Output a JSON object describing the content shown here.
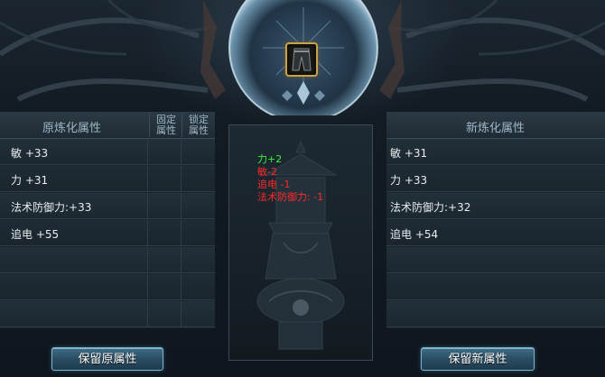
{
  "left_panel": {
    "title": "原炼化属性",
    "col_fixed": "固定属性",
    "col_lock": "锁定属性",
    "rows": [
      {
        "text": "敏 +33"
      },
      {
        "text": "力 +31"
      },
      {
        "text": "法术防御力:+33"
      },
      {
        "text": "追电 +55"
      },
      {
        "text": ""
      },
      {
        "text": ""
      },
      {
        "text": ""
      }
    ],
    "button": "保留原属性"
  },
  "right_panel": {
    "title": "新炼化属性",
    "rows": [
      {
        "text": "敏 +31"
      },
      {
        "text": "力 +33"
      },
      {
        "text": "法术防御力:+32"
      },
      {
        "text": "追电 +54"
      },
      {
        "text": ""
      },
      {
        "text": ""
      },
      {
        "text": ""
      }
    ],
    "button": "保留新属性"
  },
  "diff": [
    {
      "text": "力+2",
      "kind": "pos"
    },
    {
      "text": "敏-2",
      "kind": "neg"
    },
    {
      "text": "追电 -1",
      "kind": "neg"
    },
    {
      "text": "法术防御力: -1",
      "kind": "neg"
    }
  ],
  "colors": {
    "positive": "#3cf03c",
    "negative": "#ff2a2a",
    "item_border": "#c9a349",
    "button_border": "#7fb1c9"
  },
  "icons": {
    "item": "trousers-icon",
    "orb": "crystal-orb"
  }
}
